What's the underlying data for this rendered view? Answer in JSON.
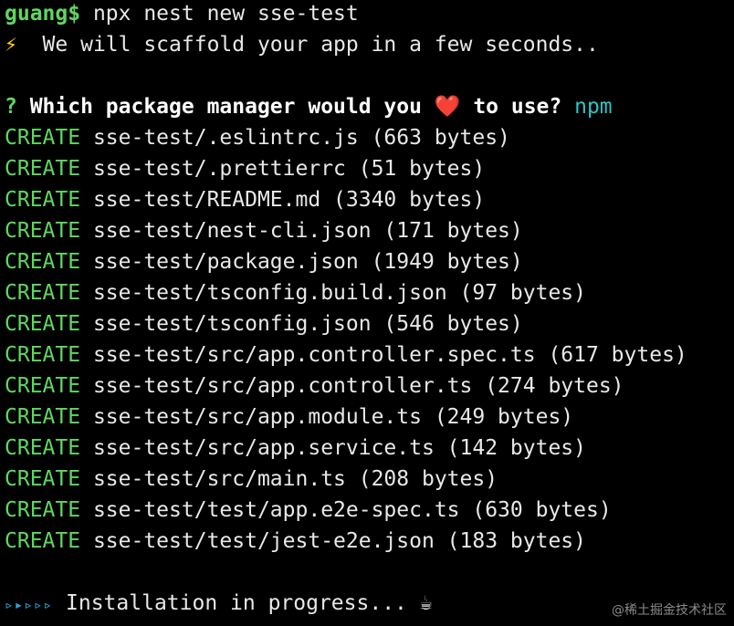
{
  "prompt": {
    "user": "guang$",
    "command": " npx nest new sse-test"
  },
  "intro": {
    "icon": "lightning-icon",
    "icon_glyph": "⚡",
    "text": "  We will scaffold your app in a few seconds.."
  },
  "question": {
    "mark": "?",
    "text_before": " Which package manager would you ",
    "heart_glyph": "❤️",
    "text_after": " to use? ",
    "answer": "npm"
  },
  "created_files": [
    {
      "action": "CREATE",
      "path": " sse-test/.eslintrc.js (663 bytes)"
    },
    {
      "action": "CREATE",
      "path": " sse-test/.prettierrc (51 bytes)"
    },
    {
      "action": "CREATE",
      "path": " sse-test/README.md (3340 bytes)"
    },
    {
      "action": "CREATE",
      "path": " sse-test/nest-cli.json (171 bytes)"
    },
    {
      "action": "CREATE",
      "path": " sse-test/package.json (1949 bytes)"
    },
    {
      "action": "CREATE",
      "path": " sse-test/tsconfig.build.json (97 bytes)"
    },
    {
      "action": "CREATE",
      "path": " sse-test/tsconfig.json (546 bytes)"
    },
    {
      "action": "CREATE",
      "path": " sse-test/src/app.controller.spec.ts (617 bytes)"
    },
    {
      "action": "CREATE",
      "path": " sse-test/src/app.controller.ts (274 bytes)"
    },
    {
      "action": "CREATE",
      "path": " sse-test/src/app.module.ts (249 bytes)"
    },
    {
      "action": "CREATE",
      "path": " sse-test/src/app.service.ts (142 bytes)"
    },
    {
      "action": "CREATE",
      "path": " sse-test/src/main.ts (208 bytes)"
    },
    {
      "action": "CREATE",
      "path": " sse-test/test/app.e2e-spec.ts (630 bytes)"
    },
    {
      "action": "CREATE",
      "path": " sse-test/test/jest-e2e.json (183 bytes)"
    }
  ],
  "install": {
    "arrows": "▹▸▹▹▹",
    "text": " Installation in progress... ",
    "coffee_glyph": "☕"
  },
  "watermark": "@稀土掘金技术社区",
  "colors": {
    "background": "#000000",
    "green": "#5fd75f",
    "cyan": "#2fc3c7",
    "text": "#e8e8e8"
  }
}
